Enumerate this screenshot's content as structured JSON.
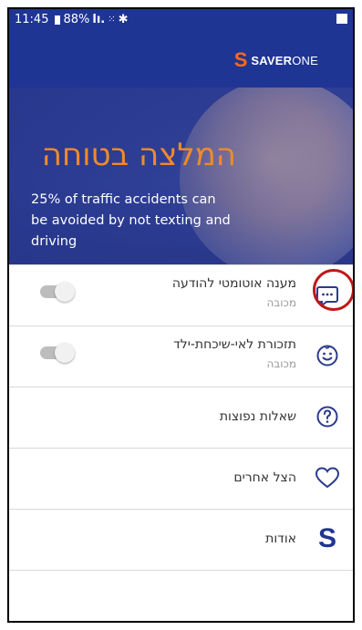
{
  "status_bar": {
    "time": "11:45",
    "battery": "88%",
    "icons": [
      "battery-icon",
      "signal-icon",
      "dots-icon",
      "bluetooth-icon",
      "photo-icon"
    ]
  },
  "header": {
    "brand_bold": "SAVER",
    "brand_light": "ONE",
    "brand_color": "#ff6a1a",
    "bar_color": "#1f3594"
  },
  "hero": {
    "title": "המלצה בטוחה",
    "subtitle": "25% of traffic accidents can be avoided by not texting and driving",
    "title_color": "#f08a2a"
  },
  "menu": {
    "auto_reply": {
      "label": "מענה אוטומטי להודעה",
      "status": "מכובה",
      "icon": "message-icon",
      "toggle": "off"
    },
    "child_reminder": {
      "label": "תזכורת לאי-שיכחת-ילד",
      "status": "מכובה",
      "icon": "smiley-icon",
      "toggle": "off"
    },
    "faq": {
      "label": "שאלות נפוצות",
      "icon": "question-icon"
    },
    "save_others": {
      "label": "הצל אחרים",
      "icon": "heart-icon"
    },
    "about": {
      "label": "אודות",
      "icon": "s-logo-icon"
    }
  }
}
